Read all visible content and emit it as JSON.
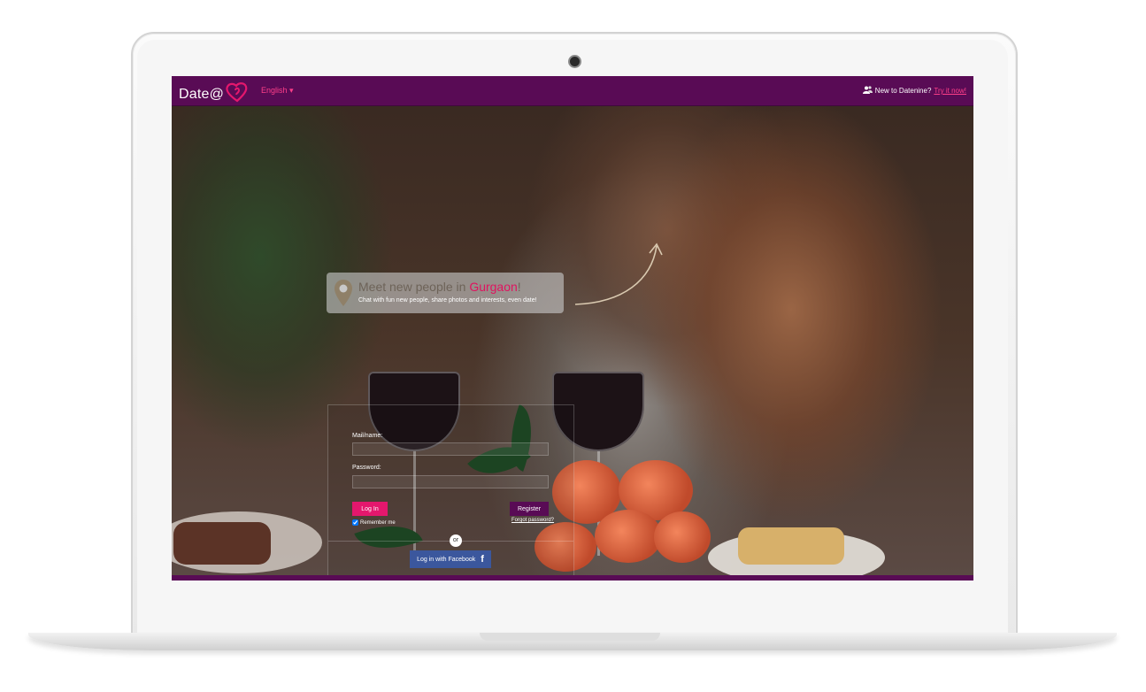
{
  "header": {
    "logo_text": "Date@",
    "language": "English",
    "new_user_text": "New to Datenine?",
    "try_link": "Try it now!"
  },
  "promo": {
    "title_prefix": "Meet new people in ",
    "city": "Gurgaon",
    "title_suffix": "!",
    "subtitle": "Chat with fun new people, share photos and interests, even date!"
  },
  "login": {
    "mail_label": "Mail/name:",
    "password_label": "Password:",
    "login_button": "Log In",
    "register_button": "Register",
    "remember_me": "Remember me",
    "forgot_password": "Forgot password?",
    "or_text": "or",
    "facebook_button": "Log in with Facebook"
  },
  "colors": {
    "brand_purple": "#590b55",
    "accent_pink": "#e4176d",
    "facebook_blue": "#3b579d"
  }
}
